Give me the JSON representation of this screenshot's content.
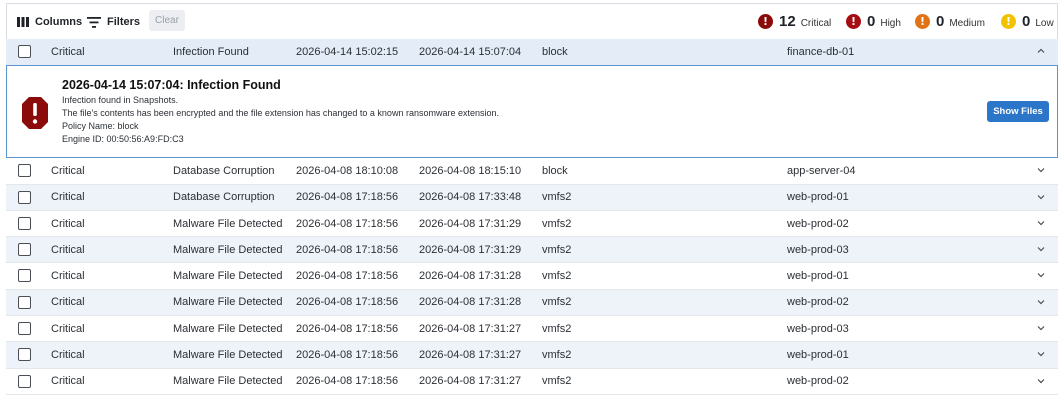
{
  "toolbar": {
    "columns_label": "Columns",
    "filters_label": "Filters",
    "clear_label": "Clear"
  },
  "severity_summary": [
    {
      "count": "12",
      "label": "Critical",
      "color": "#8b0a0a"
    },
    {
      "count": "0",
      "label": "High",
      "color": "#a50d12"
    },
    {
      "count": "0",
      "label": "Medium",
      "color": "#e07316"
    },
    {
      "count": "0",
      "label": "Low",
      "color": "#f2c200"
    }
  ],
  "expanded_row": {
    "severity": "Critical",
    "type": "Infection Found",
    "start": "2026-04-14 15:02:15",
    "end": "2026-04-14 15:07:04",
    "policy": "block",
    "host": "finance-db-01"
  },
  "detail": {
    "title": "2026-04-14 15:07:04: Infection Found",
    "line1": "Infection found in Snapshots.",
    "line2": "The file's contents has been encrypted and the file extension has changed to a known ransomware extension.",
    "line3": "Policy Name: block",
    "line4": "Engine ID: 00:50:56:A9:FD:C3",
    "button_label": "Show Files"
  },
  "rows": [
    {
      "severity": "Critical",
      "type": "Database Corruption",
      "start": "2026-04-08 18:10:08",
      "end": "2026-04-08 18:15:10",
      "policy": "block",
      "host": "app-server-04"
    },
    {
      "severity": "Critical",
      "type": "Database Corruption",
      "start": "2026-04-08 17:18:56",
      "end": "2026-04-08 17:33:48",
      "policy": "vmfs2",
      "host": "web-prod-01"
    },
    {
      "severity": "Critical",
      "type": "Malware File Detected",
      "start": "2026-04-08 17:18:56",
      "end": "2026-04-08 17:31:29",
      "policy": "vmfs2",
      "host": "web-prod-02"
    },
    {
      "severity": "Critical",
      "type": "Malware File Detected",
      "start": "2026-04-08 17:18:56",
      "end": "2026-04-08 17:31:29",
      "policy": "vmfs2",
      "host": "web-prod-03"
    },
    {
      "severity": "Critical",
      "type": "Malware File Detected",
      "start": "2026-04-08 17:18:56",
      "end": "2026-04-08 17:31:28",
      "policy": "vmfs2",
      "host": "web-prod-01"
    },
    {
      "severity": "Critical",
      "type": "Malware File Detected",
      "start": "2026-04-08 17:18:56",
      "end": "2026-04-08 17:31:28",
      "policy": "vmfs2",
      "host": "web-prod-02"
    },
    {
      "severity": "Critical",
      "type": "Malware File Detected",
      "start": "2026-04-08 17:18:56",
      "end": "2026-04-08 17:31:27",
      "policy": "vmfs2",
      "host": "web-prod-03"
    },
    {
      "severity": "Critical",
      "type": "Malware File Detected",
      "start": "2026-04-08 17:18:56",
      "end": "2026-04-08 17:31:27",
      "policy": "vmfs2",
      "host": "web-prod-01"
    },
    {
      "severity": "Critical",
      "type": "Malware File Detected",
      "start": "2026-04-08 17:18:56",
      "end": "2026-04-08 17:31:27",
      "policy": "vmfs2",
      "host": "web-prod-02"
    }
  ]
}
